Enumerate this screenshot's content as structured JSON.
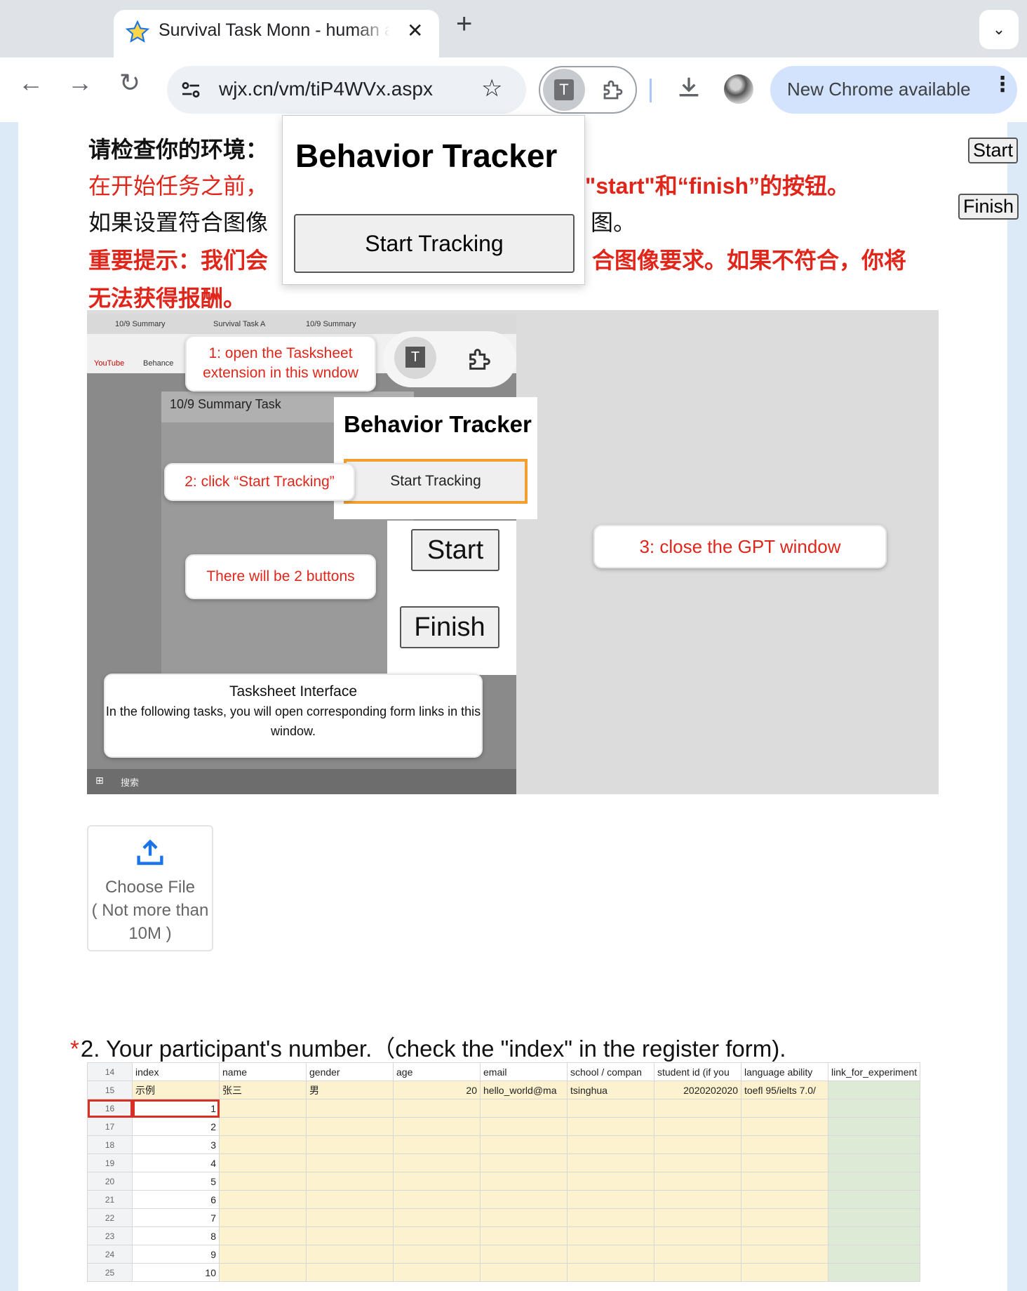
{
  "browser": {
    "tab_title": "Survival Task Monn - human a",
    "url": "wjx.cn/vm/tiP4WVx.aspx",
    "extension_letter": "T",
    "update_label": "New Chrome available"
  },
  "side_buttons": {
    "start": "Start",
    "finish": "Finish"
  },
  "environment": {
    "heading": "请检查你的环境：",
    "red_line_left": "在开始任务之前，",
    "red_line_right_a": "\"start\"和“finish”的按钮。",
    "black_line_left": "如果设置符合图像",
    "black_line_right": "图。",
    "important_left": "重要提示：我们会",
    "important_right": "合图像要求。如果不符合，你将",
    "important_line2": "无法获得报酬。"
  },
  "popup": {
    "title": "Behavior Tracker",
    "button": "Start Tracking"
  },
  "instruction_image": {
    "tab1": "10/9 Summary",
    "tab2": "Survival Task A",
    "tab3": "10/9 Summary",
    "bookmark1": "YouTube",
    "bookmark2": "Behance",
    "task_heading": "10/9 Summary Task",
    "step1": "1: open the Tasksheet extension in this wndow",
    "step2": "2: click “Start Tracking”",
    "step3": "3: close the GPT window",
    "buttons_note": "There will be 2 buttons",
    "popup_title": "Behavior Tracker",
    "popup_button": "Start Tracking",
    "zoom_start": "Start",
    "zoom_finish": "Finish",
    "tasksheet_title": "Tasksheet Interface",
    "tasksheet_desc": "In the following tasks, you will open corresponding form links in this window.",
    "taskbar_search": "搜索"
  },
  "upload": {
    "label": "Choose File",
    "limit": "( Not more than 10M )"
  },
  "question2": {
    "required": "*",
    "text": "2. Your participant's number.（check the \"index\" in the register form)."
  },
  "sheet": {
    "headers": [
      "index",
      "name",
      "gender",
      "age",
      "email",
      "school / compan",
      "student id (if you",
      "language ability",
      "link_for_experiment"
    ],
    "example_row": {
      "row": "15",
      "index": "示例",
      "name": "张三",
      "gender": "男",
      "age": "20",
      "email": "hello_world@ma",
      "school": "tsinghua",
      "student_id": "2020202020",
      "language": "toefl 95/ielts 7.0/"
    },
    "header_row": "14",
    "rows": [
      {
        "row": "16",
        "index": "1"
      },
      {
        "row": "17",
        "index": "2"
      },
      {
        "row": "18",
        "index": "3"
      },
      {
        "row": "19",
        "index": "4"
      },
      {
        "row": "20",
        "index": "5"
      },
      {
        "row": "21",
        "index": "6"
      },
      {
        "row": "22",
        "index": "7"
      },
      {
        "row": "23",
        "index": "8"
      },
      {
        "row": "24",
        "index": "9"
      },
      {
        "row": "25",
        "index": "10"
      }
    ]
  }
}
